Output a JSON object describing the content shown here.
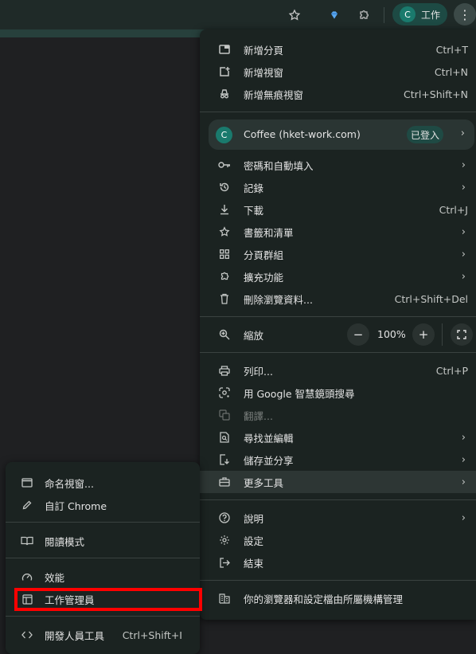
{
  "toolbar": {
    "profile_initial": "C",
    "profile_name": "工作",
    "icons": [
      "star-icon",
      "gem-icon",
      "puzzle-icon",
      "kebab-menu-icon"
    ]
  },
  "menu": {
    "new_tab": {
      "label": "新增分頁",
      "shortcut": "Ctrl+T"
    },
    "new_window": {
      "label": "新增視窗",
      "shortcut": "Ctrl+N"
    },
    "new_incognito": {
      "label": "新增無痕視窗",
      "shortcut": "Ctrl+Shift+N"
    },
    "profile": {
      "initial": "C",
      "name": "Coffee (hket-work.com)",
      "badge": "已登入"
    },
    "passwords": {
      "label": "密碼和自動填入"
    },
    "history": {
      "label": "記錄"
    },
    "downloads": {
      "label": "下載",
      "shortcut": "Ctrl+J"
    },
    "bookmarks": {
      "label": "書籤和清單"
    },
    "tab_groups": {
      "label": "分頁群組"
    },
    "extensions": {
      "label": "擴充功能"
    },
    "clear_data": {
      "label": "刪除瀏覽資料...",
      "shortcut": "Ctrl+Shift+Del"
    },
    "zoom": {
      "label": "縮放",
      "value": "100%",
      "minus": "−",
      "plus": "+"
    },
    "print": {
      "label": "列印...",
      "shortcut": "Ctrl+P"
    },
    "google_lens": {
      "label": "用 Google 智慧鏡頭搜尋"
    },
    "translate": {
      "label": "翻譯..."
    },
    "find_edit": {
      "label": "尋找並編輯"
    },
    "save_share": {
      "label": "儲存並分享"
    },
    "more_tools": {
      "label": "更多工具"
    },
    "help": {
      "label": "說明"
    },
    "settings": {
      "label": "設定"
    },
    "exit": {
      "label": "結束"
    },
    "managed": {
      "label": "你的瀏覽器和設定檔由所屬機構管理"
    }
  },
  "submenu": {
    "name_window": {
      "label": "命名視窗..."
    },
    "customize_chrome": {
      "label": "自訂 Chrome"
    },
    "reading_mode": {
      "label": "閱讀模式"
    },
    "performance": {
      "label": "效能"
    },
    "task_manager": {
      "label": "工作管理員"
    },
    "dev_tools": {
      "label": "開發人員工具",
      "shortcut": "Ctrl+Shift+I"
    }
  },
  "colors": {
    "highlight": "#ff0000",
    "menu_bg": "#1b2321",
    "accent": "#1a7a6d"
  }
}
